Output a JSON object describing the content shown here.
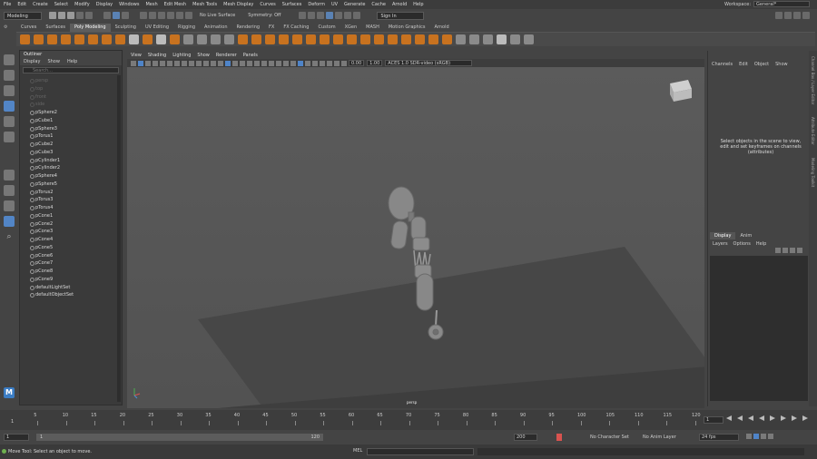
{
  "menubar": {
    "items": [
      "File",
      "Edit",
      "Create",
      "Select",
      "Modify",
      "Display",
      "Windows",
      "Mesh",
      "Edit Mesh",
      "Mesh Tools",
      "Mesh Display",
      "Curves",
      "Surfaces",
      "Deform",
      "UV",
      "Generate",
      "Cache",
      "Arnold",
      "Help"
    ],
    "workspace_label": "Workspace:",
    "workspace_value": "General*"
  },
  "statusline": {
    "mode": "Modeling",
    "live_surface": "No Live Surface",
    "symmetry": "Symmetry: Off",
    "sign_in": "Sign In"
  },
  "shelf": {
    "tabs": [
      "Curves",
      "Surfaces",
      "Poly Modeling",
      "Sculpting",
      "UV Editing",
      "Rigging",
      "Animation",
      "Rendering",
      "FX",
      "FX Caching",
      "Custom",
      "XGen",
      "MASH",
      "Motion Graphics",
      "Arnold"
    ],
    "active_tab": "Poly Modeling"
  },
  "outliner": {
    "title": "Outliner",
    "menu": [
      "Display",
      "Show",
      "Help"
    ],
    "search_placeholder": "Search...",
    "items": [
      {
        "name": "persp",
        "dim": true
      },
      {
        "name": "top",
        "dim": true
      },
      {
        "name": "front",
        "dim": true
      },
      {
        "name": "side",
        "dim": true
      },
      {
        "name": "pSphere2",
        "dim": false
      },
      {
        "name": "pCube1",
        "dim": false
      },
      {
        "name": "pSphere3",
        "dim": false
      },
      {
        "name": "pTorus1",
        "dim": false
      },
      {
        "name": "pCube2",
        "dim": false
      },
      {
        "name": "pCube3",
        "dim": false
      },
      {
        "name": "pCylinder1",
        "dim": false
      },
      {
        "name": "pCylinder2",
        "dim": false
      },
      {
        "name": "pSphere4",
        "dim": false
      },
      {
        "name": "pSphere5",
        "dim": false
      },
      {
        "name": "pTorus2",
        "dim": false
      },
      {
        "name": "pTorus3",
        "dim": false
      },
      {
        "name": "pTorus4",
        "dim": false
      },
      {
        "name": "pCone1",
        "dim": false
      },
      {
        "name": "pCone2",
        "dim": false
      },
      {
        "name": "pCone3",
        "dim": false
      },
      {
        "name": "pCone4",
        "dim": false
      },
      {
        "name": "pCone5",
        "dim": false
      },
      {
        "name": "pCone6",
        "dim": false
      },
      {
        "name": "pCone7",
        "dim": false
      },
      {
        "name": "pCone8",
        "dim": false
      },
      {
        "name": "pCone9",
        "dim": false
      },
      {
        "name": "defaultLightSet",
        "dim": false
      },
      {
        "name": "defaultObjectSet",
        "dim": false
      }
    ]
  },
  "viewport": {
    "menu": [
      "View",
      "Shading",
      "Lighting",
      "Show",
      "Renderer",
      "Panels"
    ],
    "field_a": "0.00",
    "field_b": "1.00",
    "color_space": "ACES 1.0 SDR-video (sRGB)",
    "camera_label": "persp",
    "viewcube_face": "FRONT"
  },
  "channelbox": {
    "menu": [
      "Channels",
      "Edit",
      "Object",
      "Show"
    ],
    "message": "Select objects in the scene to view, edit and set keyframes on channels (attributes)",
    "layer_tabs": [
      "Display",
      "Anim"
    ],
    "layer_menu": [
      "Layers",
      "Options",
      "Help"
    ],
    "side_tabs": [
      "Channel Box / Layer Editor",
      "Attribute Editor",
      "Modeling Toolkit"
    ]
  },
  "timeslider": {
    "ticks": [
      "5",
      "10",
      "15",
      "20",
      "25",
      "30",
      "35",
      "40",
      "45",
      "50",
      "55",
      "60",
      "65",
      "70",
      "75",
      "80",
      "85",
      "90",
      "95",
      "100",
      "105",
      "110",
      "115",
      "120"
    ],
    "first_frame": "1",
    "current_frame": "1"
  },
  "range": {
    "start": "1",
    "start_inner": "1",
    "end_inner": "120",
    "end": "200",
    "character_set": "No Character Set",
    "anim_layer": "No Anim Layer",
    "fps": "24 fps"
  },
  "cmdline": {
    "help_text": "Move Tool: Select an object to move.",
    "mel_label": "MEL"
  },
  "colors": {
    "accent": "#5285c6",
    "shelf_icon": "#c8721f"
  }
}
